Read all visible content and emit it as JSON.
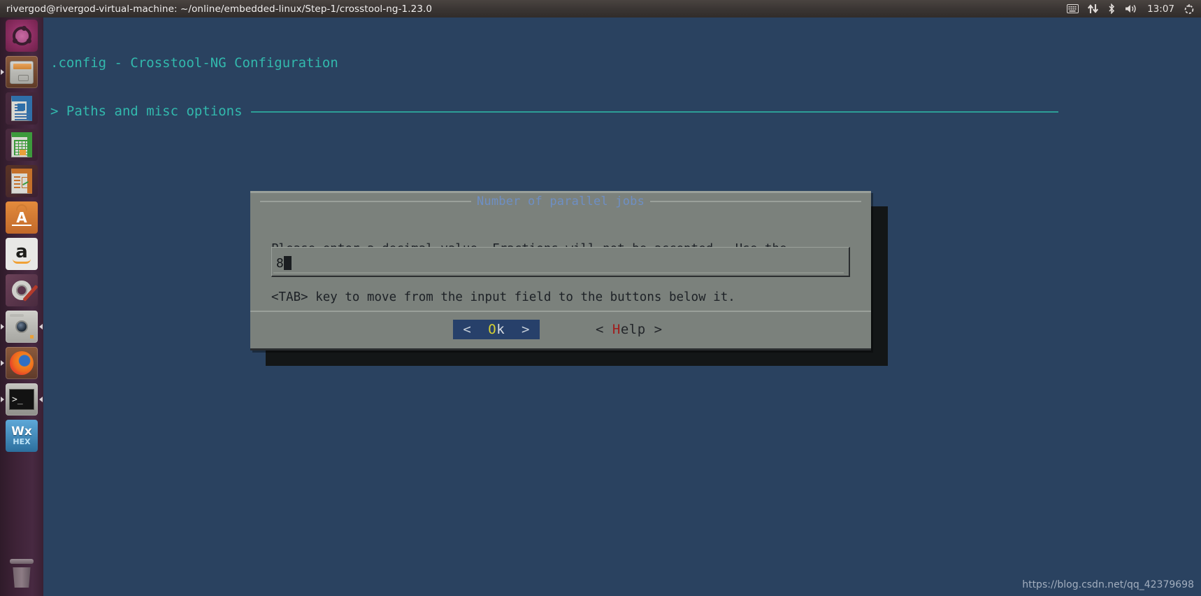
{
  "top_panel": {
    "window_title": "rivergod@rivergod-virtual-machine: ~/online/embedded-linux/Step-1/crosstool-ng-1.23.0",
    "tray": {
      "clock": "13:07",
      "icons": [
        "keyboard-icon",
        "network-icon",
        "bluetooth-icon",
        "volume-icon",
        "system-menu-icon"
      ]
    }
  },
  "launcher": {
    "items": [
      {
        "name": "ubuntu-dash",
        "label": "Dash home",
        "running": false
      },
      {
        "name": "files",
        "label": "Files",
        "running": true
      },
      {
        "name": "libreoffice-writer",
        "label": "LibreOffice Writer",
        "running": false
      },
      {
        "name": "libreoffice-calc",
        "label": "LibreOffice Calc",
        "running": false
      },
      {
        "name": "libreoffice-impress",
        "label": "LibreOffice Impress",
        "running": false
      },
      {
        "name": "ubuntu-software",
        "label": "Ubuntu Software",
        "running": false
      },
      {
        "name": "amazon",
        "label": "Amazon",
        "running": false
      },
      {
        "name": "system-settings",
        "label": "System Settings",
        "running": false
      },
      {
        "name": "cheese-webcam",
        "label": "Cheese Webcam Booth",
        "running": true
      },
      {
        "name": "firefox",
        "label": "Firefox Web Browser",
        "running": true
      },
      {
        "name": "terminal",
        "label": "Terminal",
        "running": true
      },
      {
        "name": "wxhexeditor",
        "label": "wxHexEditor",
        "running": false
      }
    ],
    "trash": {
      "name": "trash",
      "label": "Trash"
    }
  },
  "terminal": {
    "menu_title": ".config - Crosstool-NG Configuration",
    "menu_path": "> Paths and misc options"
  },
  "dialog": {
    "title": "Number of parallel jobs",
    "message_line1": "Please enter a decimal value. Fractions will not be accepted.  Use the",
    "message_line2": "<TAB> key to move from the input field to the buttons below it.",
    "input": {
      "value": "8",
      "placeholder": ""
    },
    "buttons": [
      {
        "name": "ok-button",
        "bracket_left": "<",
        "hotkey": "O",
        "rest": "k",
        "bracket_right": ">",
        "selected": true
      },
      {
        "name": "help-button",
        "bracket_left": "<",
        "hotkey": "H",
        "rest": "elp",
        "bracket_right": ">",
        "selected": false
      }
    ]
  },
  "watermark": {
    "text": "https://blog.csdn.net/qq_42379698"
  },
  "colors": {
    "terminal_bg": "#2a4260",
    "terminal_fg": "#32b9ad",
    "dialog_bg": "#7b817c",
    "dialog_title_fg": "#6e8fc4",
    "selected_button_bg": "#27406a",
    "hotkey_yellow": "#d8d232",
    "hotkey_red": "#a01c1c",
    "panel_bg": "#3b3634",
    "launcher_bg": "#3d2236"
  }
}
